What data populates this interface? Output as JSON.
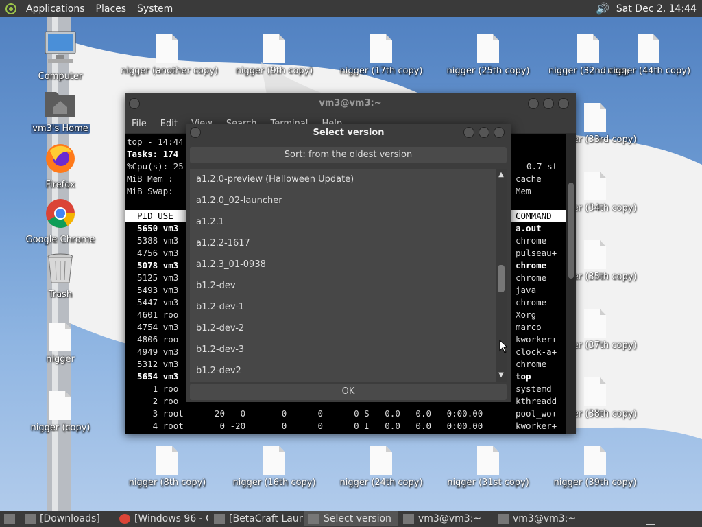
{
  "top_panel": {
    "menus": [
      "Applications",
      "Places",
      "System"
    ],
    "clock": "Sat Dec 2, 14:44"
  },
  "desktop_left": [
    {
      "label": "Computer"
    },
    {
      "label": "vm3's Home"
    },
    {
      "label": "Firefox"
    },
    {
      "label": "Google Chrome"
    },
    {
      "label": "Trash"
    },
    {
      "label": "nigger"
    },
    {
      "label": "nigger (copy)"
    }
  ],
  "desktop_top": [
    "nigger (another copy)",
    "nigger (9th copy)",
    "nigger (17th copy)",
    "nigger (25th copy)",
    "nigger (32nd copy)",
    "nigger (44th copy)"
  ],
  "desktop_right": [
    "nigger (33rd copy)",
    "nigger (34th copy)",
    "nigger (35th copy)",
    "nigger (37th copy)",
    "nigger (38th copy)"
  ],
  "desktop_bottom": [
    "nigger (8th copy)",
    "nigger (16th copy)",
    "nigger (24th copy)",
    "nigger (31st copy)",
    "nigger (39th copy)"
  ],
  "terminal": {
    "title": "vm3@vm3:~",
    "menu": [
      "File",
      "Edit",
      "View",
      "Search",
      "Terminal",
      "Help"
    ],
    "summary": [
      "top - 14:44",
      "Tasks: 174",
      "%Cpu(s): 25",
      "MiB Mem :",
      "MiB Swap:"
    ],
    "summary_right": [
      "0.7 st",
      "cache",
      "Mem"
    ],
    "header_left": "  PID USE",
    "header_right": "COMMAND",
    "rows": [
      {
        "left": "  5650 vm3",
        "cmd": "a.out",
        "bold": true
      },
      {
        "left": "  5388 vm3",
        "cmd": "chrome",
        "bold": false
      },
      {
        "left": "  4756 vm3",
        "cmd": "pulseau+",
        "bold": false
      },
      {
        "left": "  5078 vm3",
        "cmd": "chrome",
        "bold": true
      },
      {
        "left": "  5125 vm3",
        "cmd": "chrome",
        "bold": false
      },
      {
        "left": "  5493 vm3",
        "cmd": "java",
        "bold": false
      },
      {
        "left": "  5447 vm3",
        "cmd": "chrome",
        "bold": false
      },
      {
        "left": "  4601 roo",
        "cmd": "Xorg",
        "bold": false
      },
      {
        "left": "  4754 vm3",
        "cmd": "marco",
        "bold": false
      },
      {
        "left": "  4806 roo",
        "cmd": "kworker+",
        "bold": false
      },
      {
        "left": "  4949 vm3",
        "cmd": "clock-a+",
        "bold": false
      },
      {
        "left": "  5312 vm3",
        "cmd": "chrome",
        "bold": false
      },
      {
        "left": "  5654 vm3",
        "cmd": "top",
        "bold": true
      },
      {
        "left": "     1 roo",
        "cmd": "systemd",
        "bold": false
      },
      {
        "left": "     2 roo",
        "cmd": "kthreadd",
        "bold": false
      },
      {
        "left": "     3 root      20   0       0      0      0 S   0.0   0.0   0:00.00",
        "cmd": "pool_wo+",
        "bold": false
      },
      {
        "left": "     4 root       0 -20       0      0      0 I   0.0   0.0   0:00.00",
        "cmd": "kworker+",
        "bold": false
      }
    ]
  },
  "dialog": {
    "title": "Select version",
    "sort_label": "Sort: from the oldest version",
    "items": [
      "a1.2.0-preview (Halloween Update)",
      "a1.2.0_02-launcher",
      "a1.2.1",
      "a1.2.2-1617",
      "a1.2.3_01-0938",
      "b1.2-dev",
      "b1.2-dev-1",
      "b1.2-dev-2",
      "b1.2-dev-3",
      "b1.2-dev2"
    ],
    "ok_label": "OK",
    "scroll_position": 0.52
  },
  "taskbar": {
    "tasks": [
      {
        "label": "[Downloads]",
        "active": false
      },
      {
        "label": "[Windows 96 - G...",
        "active": false
      },
      {
        "label": "[BetaCraft Launc...",
        "active": false
      },
      {
        "label": "Select version",
        "active": true
      },
      {
        "label": "vm3@vm3:~",
        "active": false
      },
      {
        "label": "vm3@vm3:~",
        "active": false
      }
    ]
  }
}
